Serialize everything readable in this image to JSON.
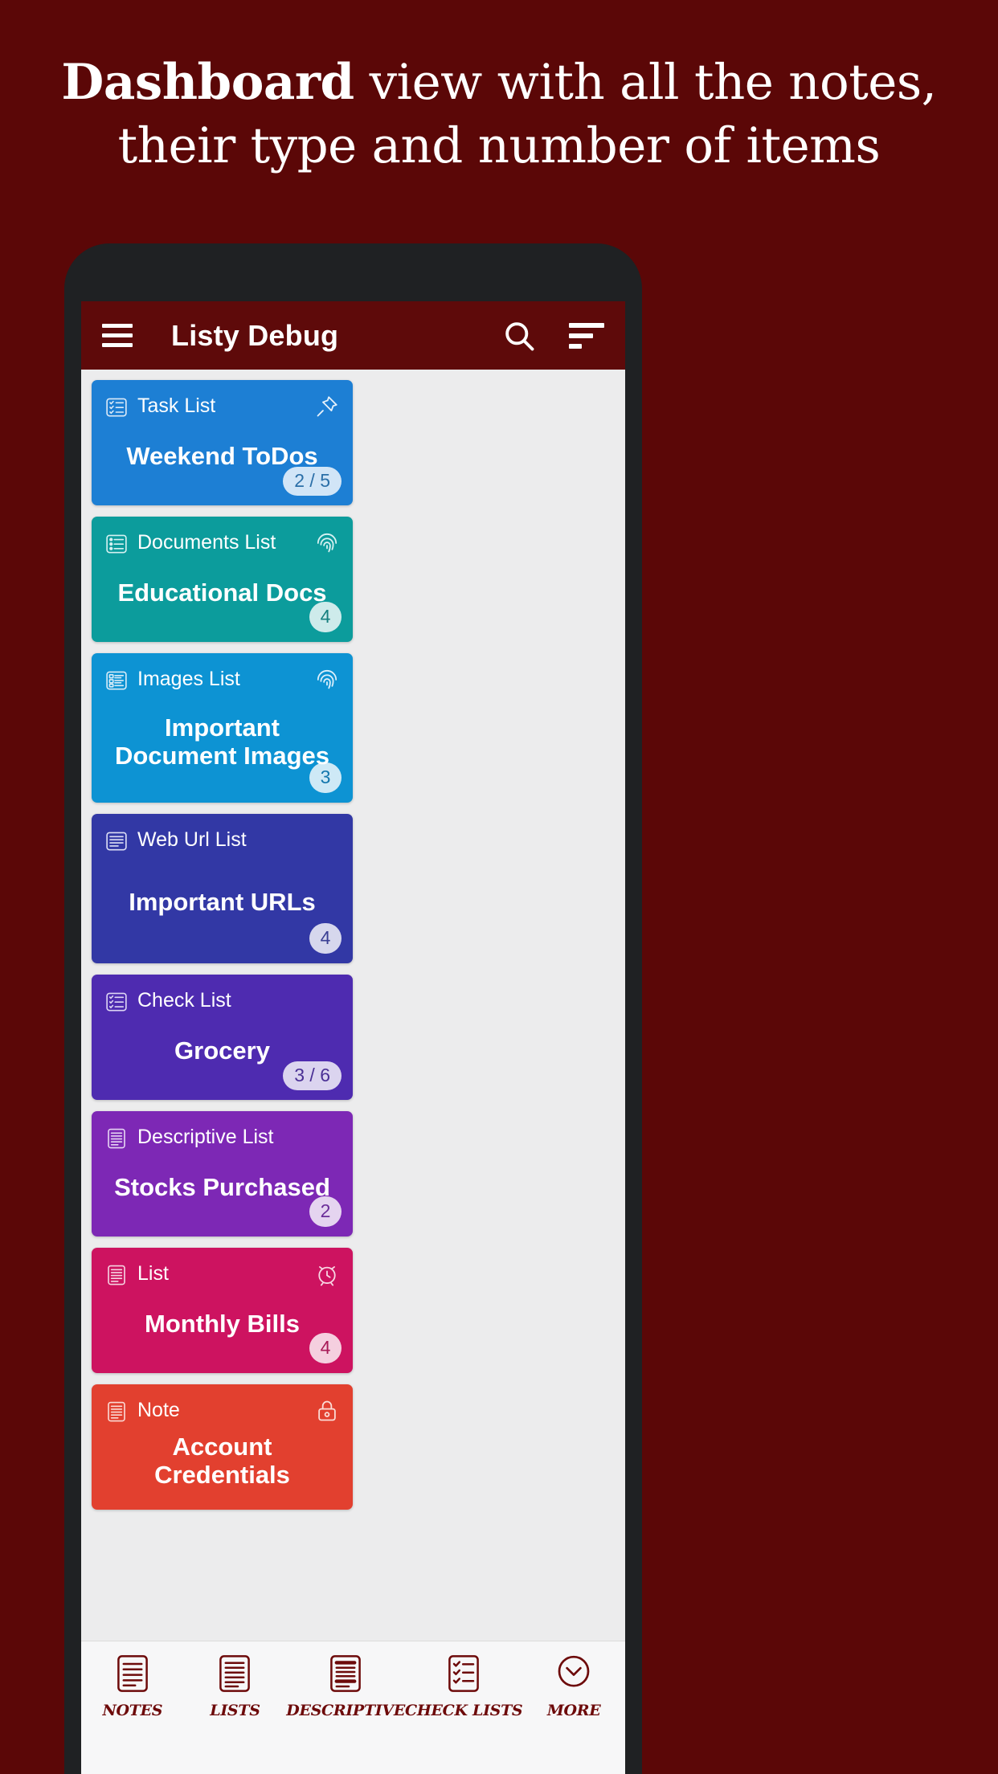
{
  "promo": {
    "lead": "Dashboard",
    "rest": " view with all the notes,",
    "line2": "their type and number of items"
  },
  "appbar": {
    "menu_icon": "hamburger-menu-icon",
    "title": "Listy Debug",
    "search_icon": "search-icon",
    "sort_icon": "sort-filter-icon"
  },
  "colors": {
    "promo_bg": "#5b0707",
    "appbar_bg": "#5e0a0a",
    "screen_bg": "#ececed",
    "nav_label": "#6d0a0a"
  },
  "cards": [
    {
      "type": "Task List",
      "title": "Weekend ToDos",
      "count": "2 / 5",
      "bg": "#1d7fd4",
      "type_icon": "task-list-icon",
      "badge_icon": "pushpin-icon",
      "count_color": "#2b6fa8",
      "count_shape": "pill"
    },
    {
      "type": "Documents List",
      "title": "Educational Docs",
      "count": "4",
      "bg": "#0c9c9c",
      "type_icon": "documents-list-icon",
      "badge_icon": "fingerprint-icon",
      "count_color": "#167f7f",
      "count_shape": "circle"
    },
    {
      "type": "Images List",
      "title": "Important Document Images",
      "count": "3",
      "bg": "#0d93d3",
      "type_icon": "images-list-icon",
      "badge_icon": "fingerprint-icon",
      "count_color": "#1377ad",
      "count_shape": "circle"
    },
    {
      "type": "Web Url List",
      "title": "Important URLs",
      "count": "4",
      "bg": "#3238a5",
      "type_icon": "web-url-list-icon",
      "badge_icon": "",
      "count_color": "#3a3f94",
      "count_shape": "circle"
    },
    {
      "type": "Check List",
      "title": "Grocery",
      "count": "3 / 6",
      "bg": "#4e2bb0",
      "type_icon": "check-list-icon",
      "badge_icon": "",
      "count_color": "#4a3095",
      "count_shape": "pill"
    },
    {
      "type": "Descriptive List",
      "title": "Stocks Purchased",
      "count": "2",
      "bg": "#7d28b5",
      "type_icon": "descriptive-list-icon",
      "badge_icon": "",
      "count_color": "#6b2d99",
      "count_shape": "circle"
    },
    {
      "type": "List",
      "title": "Monthly Bills",
      "count": "4",
      "bg": "#cd1360",
      "type_icon": "list-icon",
      "badge_icon": "alarm-clock-icon",
      "count_color": "#a81a57",
      "count_shape": "circle"
    },
    {
      "type": "Note",
      "title": "Account Credentials",
      "count": "",
      "bg": "#e2402f",
      "type_icon": "note-icon",
      "badge_icon": "lock-icon",
      "count_color": "#b7392c",
      "count_shape": "circle"
    }
  ],
  "bottomnav": [
    {
      "label": "NOTES",
      "icon": "note-lines-icon"
    },
    {
      "label": "LISTS",
      "icon": "list-lines-icon"
    },
    {
      "label": "DESCRIPTIVE",
      "icon": "descriptive-lines-icon"
    },
    {
      "label": "CHECK LISTS",
      "icon": "checklist-icon"
    },
    {
      "label": "MORE",
      "icon": "chevron-down-circle-icon"
    }
  ]
}
